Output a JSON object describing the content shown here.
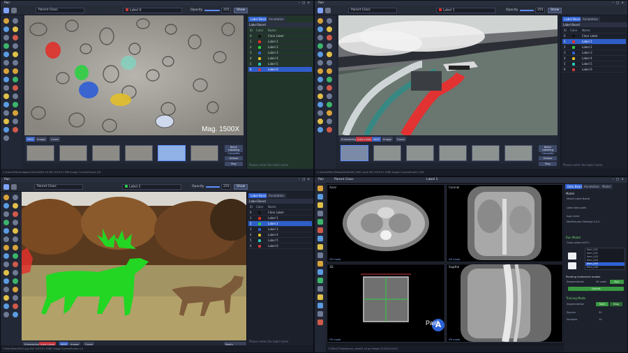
{
  "quadrants": [
    {
      "app_title": "Pair",
      "category": {
        "label": "Parent Class"
      },
      "current_label": {
        "label": "Label 6",
        "color": "#d23a3a"
      },
      "opacity": {
        "label": "Opacity",
        "value": "255",
        "fraction": 1.0
      },
      "show_button": "Show",
      "tabs": [
        "Label Board",
        "Annotation"
      ],
      "label_board_title": "Label Board",
      "columns": [
        "ID",
        "Color",
        "Name"
      ],
      "labels": [
        {
          "id": "0",
          "color": "#111111",
          "name": "Clear Label"
        },
        {
          "id": "1",
          "color": "#e0312b",
          "name": "Label 1"
        },
        {
          "id": "2",
          "color": "#2fcf45",
          "name": "Label 2"
        },
        {
          "id": "3",
          "color": "#2f5ed6",
          "name": "Label 3"
        },
        {
          "id": "4",
          "color": "#e2bf2a",
          "name": "Label 4"
        },
        {
          "id": "5",
          "color": "#28c7b2",
          "name": "Label 5"
        },
        {
          "id": "6",
          "color": "#d23a3a",
          "name": "Label 6"
        }
      ],
      "selected_index": 6,
      "overlay_text": "Mag. 1500X",
      "frame_buttons": [
        "MMS",
        "Image",
        "Cover"
      ],
      "thumb_side": [
        "Batch Labelling",
        "Complete",
        "Scissor",
        "Play"
      ],
      "footer_hint": "Please enter the label name",
      "status": "C:/Users/Pair/Images/Cell/Cell001.tif   SW 1024  IH 768  Image CurrentFrame 1/6"
    },
    {
      "app_title": "Pair",
      "category": {
        "label": "Parent Class"
      },
      "current_label": {
        "label": "Label 1",
        "color": "#e0312b"
      },
      "opacity": {
        "label": "Opacity",
        "value": "255",
        "fraction": 1.0
      },
      "show_button": "Show",
      "tabs": [
        "Label Board",
        "Annotation"
      ],
      "label_board_title": "Label Board",
      "columns": [
        "ID",
        "Color",
        "Name"
      ],
      "labels": [
        {
          "id": "0",
          "color": "#111111",
          "name": "Clear Label"
        },
        {
          "id": "1",
          "color": "#e0312b",
          "name": "Label 1"
        },
        {
          "id": "2",
          "color": "#2fcf45",
          "name": "Label 2"
        },
        {
          "id": "3",
          "color": "#2f5ed6",
          "name": "Label 3"
        },
        {
          "id": "4",
          "color": "#e2bf2a",
          "name": "Label 4"
        },
        {
          "id": "5",
          "color": "#28c7b2",
          "name": "Label 5"
        },
        {
          "id": "6",
          "color": "#d23a3a",
          "name": "Label 6"
        }
      ],
      "selected_index": 1,
      "frame_buttons": [
        "Embedding",
        "Auto Label",
        "MMS",
        "Image",
        "Cover"
      ],
      "thumb_side": [
        "Batch Labelling",
        "Complete",
        "Scissor",
        "Play"
      ],
      "footer_hint": "Please enter the label name",
      "status": "C:/Users/Pair/Videos/Drift/drift_0001.mp4   SW 1920  IH 1080  Image CurrentFrame 1/94"
    },
    {
      "app_title": "Pair",
      "category": {
        "label": "Parent Class"
      },
      "current_label": {
        "label": "Label 2",
        "color": "#2fcf45"
      },
      "opacity": {
        "label": "Opacity",
        "value": "255",
        "fraction": 1.0
      },
      "show_button": "Show",
      "tabs": [
        "Label Board",
        "Annotation"
      ],
      "label_board_title": "Label Board",
      "columns": [
        "ID",
        "Color",
        "Name"
      ],
      "labels": [
        {
          "id": "0",
          "color": "#111111",
          "name": "Clear Label"
        },
        {
          "id": "1",
          "color": "#e0312b",
          "name": "Label 1"
        },
        {
          "id": "2",
          "color": "#2fcf45",
          "name": "Label 2"
        },
        {
          "id": "3",
          "color": "#2f5ed6",
          "name": "Label 3"
        },
        {
          "id": "4",
          "color": "#e2bf2a",
          "name": "Label 4"
        },
        {
          "id": "5",
          "color": "#28c7b2",
          "name": "Label 5"
        },
        {
          "id": "6",
          "color": "#d23a3a",
          "name": "Label 6"
        }
      ],
      "selected_index": 2,
      "frame_buttons": [
        "Embedding",
        "Auto Label",
        "MMS",
        "Image",
        "Cover"
      ],
      "thumb_side": [
        "Batch Labelling"
      ],
      "footer_hint": "Please enter the label name",
      "status": "F:/Pair/Deer/0001.jpg   SW 1920  IH 1080  Image CurrentFrame 1/1"
    }
  ],
  "medical": {
    "app_title": "Pair",
    "top_label": "Parent Class",
    "top_mid": "Label 1",
    "tabs": [
      "Data Board",
      "Annotation",
      "Model"
    ],
    "views": [
      {
        "label": "Axial",
        "badge": "VR mode"
      },
      {
        "label": "Coronal",
        "badge": "VR mode"
      },
      {
        "label": "3D",
        "badge": "VR mode"
      },
      {
        "label": "Sagittal",
        "badge": "VR mode"
      }
    ],
    "panel": {
      "section1": "Model",
      "field1": "Model Label Board",
      "field2": "Label data path",
      "field3": "App name",
      "field3_value": "MedPair.exe   Settings 0.0.0",
      "section2": "Run Model",
      "dropdown": "Class select    AUTO",
      "files": [
        "Item_001",
        "Item_002",
        "Item_003",
        "Item_004",
        "Item_005",
        "Item_006"
      ],
      "selected_file": 4,
      "section3": "Pending treatment modes",
      "seg_label": "Segmentation",
      "seg_state": "All Label",
      "run_button": "Run",
      "apply_button": "Submit",
      "section4": "Training Mode",
      "train_label": "Segmentation",
      "train_btn1": "Start",
      "train_btn2": "Stop",
      "epoch_label": "Epochs",
      "epoch_value": "50",
      "sample_label": "Samples",
      "sample_value": "10"
    },
    "logo_letter": "A",
    "logo_text": "Pair",
    "logo_sup": "®",
    "status": "F:/Pair/CT/abdomen_case01.nii.gz    Image 512x512x210"
  }
}
